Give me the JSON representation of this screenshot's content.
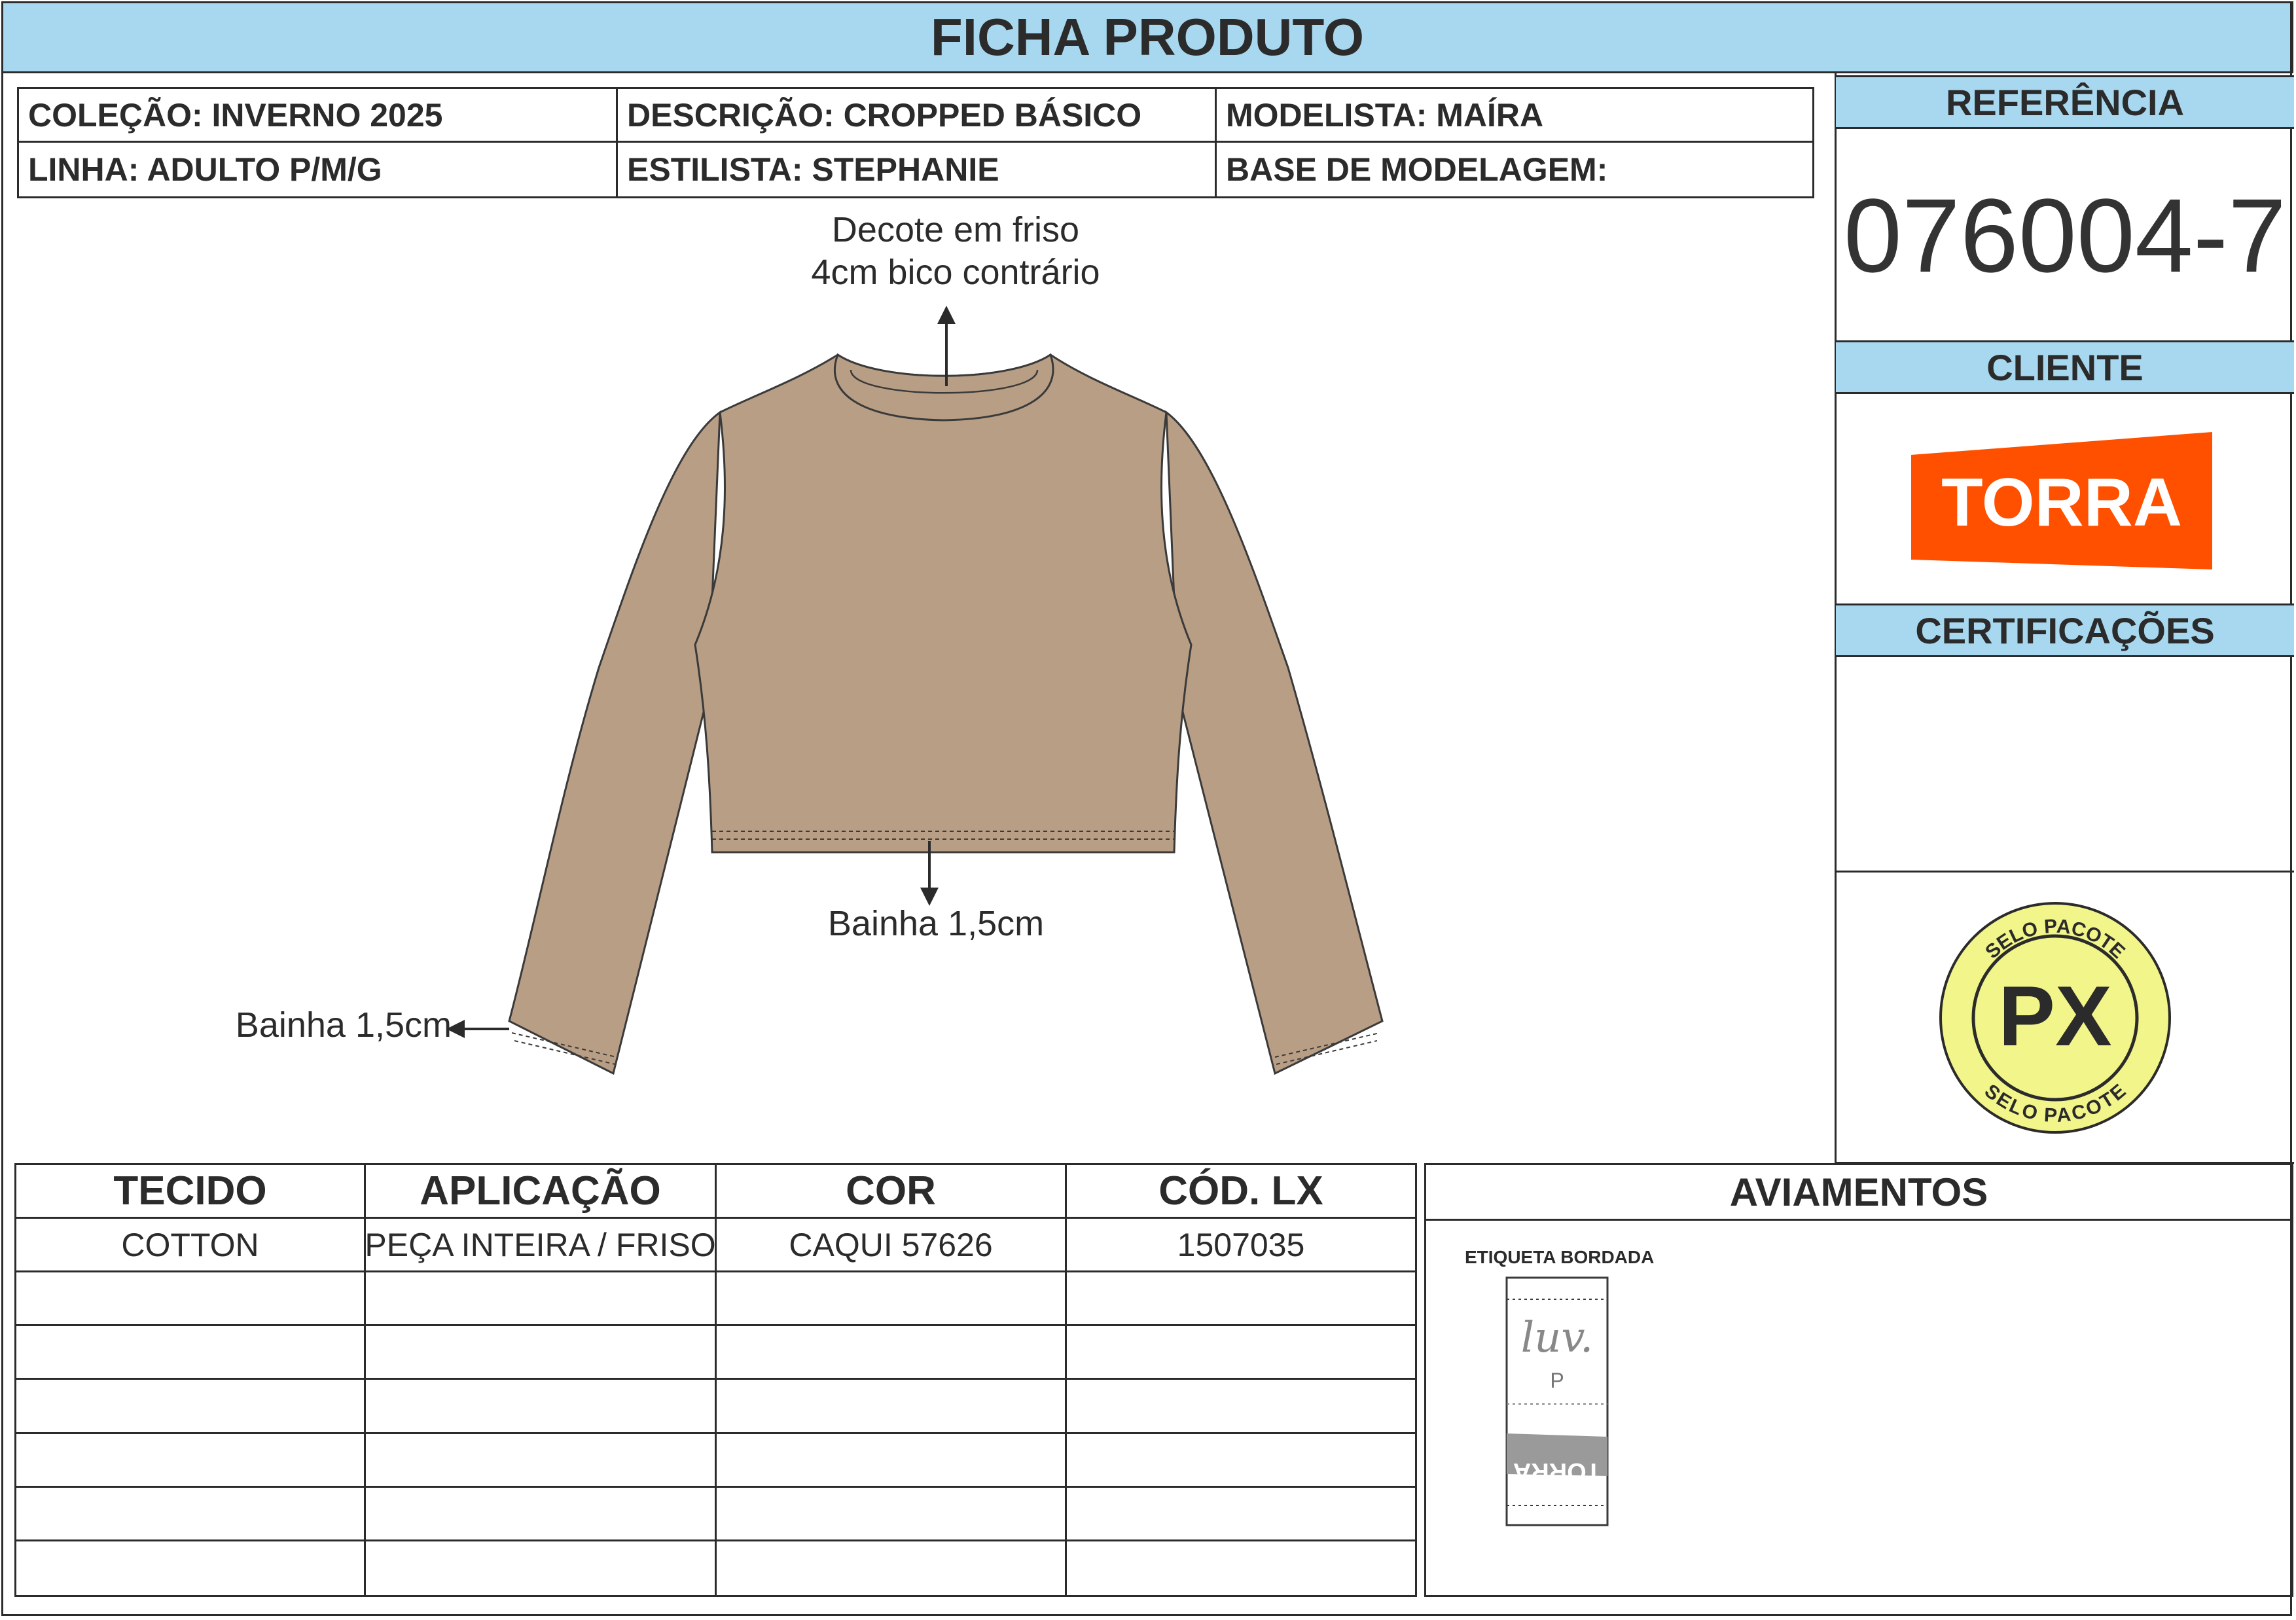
{
  "header": {
    "title": "FICHA PRODUTO"
  },
  "info": {
    "colecao": "COLEÇÃO: INVERNO 2025",
    "descricao": "DESCRIÇÃO: CROPPED BÁSICO",
    "modelista": "MODELISTA: MAÍRA",
    "linha": "LINHA: ADULTO P/M/G",
    "estilista": "ESTILISTA: STEPHANIE",
    "base": "BASE DE MODELAGEM:"
  },
  "sidebar": {
    "referencia_label": "REFERÊNCIA",
    "referencia_value": "076004-7",
    "cliente_label": "CLIENTE",
    "cliente_logo": "TORRA",
    "certificacoes_label": "CERTIFICAÇÕES",
    "seal_text_top": "SELO PACOTE",
    "seal_text_bottom": "SELO PACOTE",
    "seal_center": "PX"
  },
  "drawing": {
    "neck_note_line1": "Decote em friso",
    "neck_note_line2": "4cm bico contrário",
    "hem_note": "Bainha 1,5cm",
    "sleeve_note": "Bainha 1,5cm",
    "garment_color": "#b89e85"
  },
  "table": {
    "headers": [
      "TECIDO",
      "APLICAÇÃO",
      "COR",
      "CÓD. LX"
    ],
    "rows": [
      [
        "COTTON",
        "PEÇA INTEIRA / FRISO",
        "CAQUI 57626",
        "1507035"
      ],
      [
        "",
        "",
        "",
        ""
      ],
      [
        "",
        "",
        "",
        ""
      ],
      [
        "",
        "",
        "",
        ""
      ],
      [
        "",
        "",
        "",
        ""
      ],
      [
        "",
        "",
        "",
        ""
      ],
      [
        "",
        "",
        "",
        ""
      ]
    ]
  },
  "aviamentos": {
    "title": "AVIAMENTOS",
    "label_title": "ETIQUETA BORDADA",
    "label_brand": "luv.",
    "label_size": "P",
    "label_logo": "TORRA"
  },
  "colors": {
    "accent": "#a8d8ef",
    "brand": "#ff5000",
    "seal": "#f2f58a"
  }
}
